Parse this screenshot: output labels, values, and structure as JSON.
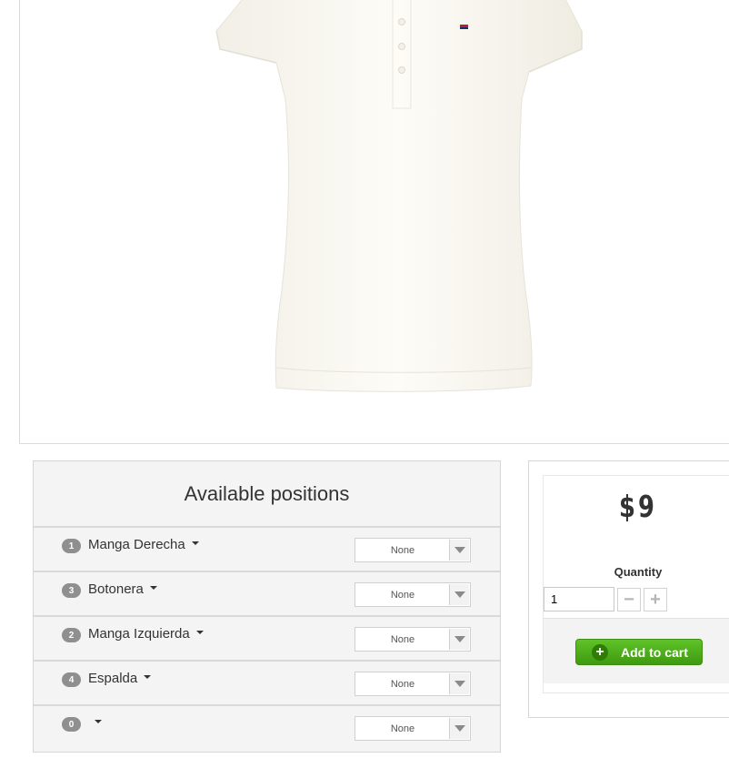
{
  "positions_panel": {
    "title": "Available positions",
    "rows": [
      {
        "badge": "1",
        "name": "Manga Derecha",
        "selected": "None"
      },
      {
        "badge": "3",
        "name": "Botonera",
        "selected": "None"
      },
      {
        "badge": "2",
        "name": "Manga Izquierda",
        "selected": "None"
      },
      {
        "badge": "4",
        "name": "Espalda",
        "selected": "None"
      },
      {
        "badge": "0",
        "name": "",
        "selected": "None"
      }
    ]
  },
  "buy_box": {
    "price": "$9",
    "quantity_label": "Quantity",
    "quantity_value": "1",
    "minus_symbol": "−",
    "plus_symbol": "+",
    "add_to_cart_label": "Add to cart",
    "add_icon_symbol": "+",
    "button_color": "#4fb41c"
  },
  "product_image": {
    "icon": "white-polo-shirt-image",
    "garment_color": "#fdfcf7"
  }
}
